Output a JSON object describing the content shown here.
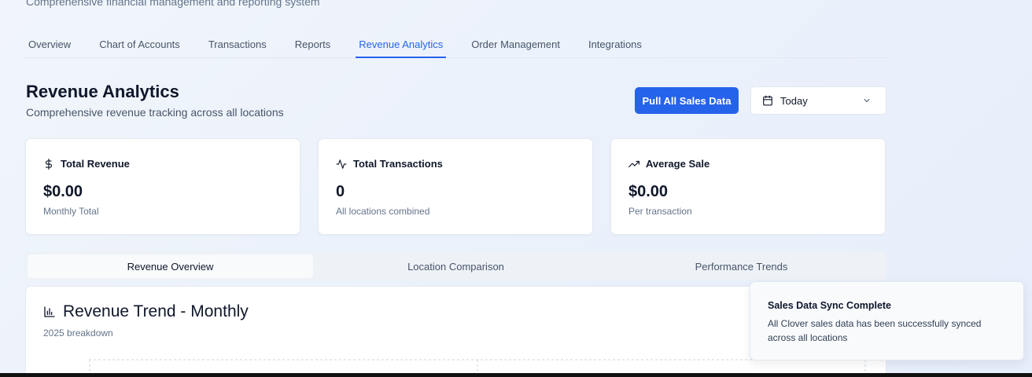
{
  "header": {
    "subtitle": "Comprehensive financial management and reporting system"
  },
  "nav": {
    "tabs": [
      {
        "label": "Overview"
      },
      {
        "label": "Chart of Accounts"
      },
      {
        "label": "Transactions"
      },
      {
        "label": "Reports"
      },
      {
        "label": "Revenue Analytics",
        "active": true
      },
      {
        "label": "Order Management"
      },
      {
        "label": "Integrations"
      }
    ]
  },
  "page": {
    "title": "Revenue Analytics",
    "description": "Comprehensive revenue tracking across all locations",
    "pull_button": "Pull All Sales Data",
    "date_range": {
      "selected": "Today"
    }
  },
  "stats": [
    {
      "icon": "dollar-icon",
      "label": "Total Revenue",
      "value": "$0.00",
      "sub": "Monthly Total"
    },
    {
      "icon": "activity-icon",
      "label": "Total Transactions",
      "value": "0",
      "sub": "All locations combined"
    },
    {
      "icon": "trending-up-icon",
      "label": "Average Sale",
      "value": "$0.00",
      "sub": "Per transaction"
    }
  ],
  "subtabs": [
    {
      "label": "Revenue Overview",
      "active": true
    },
    {
      "label": "Location Comparison"
    },
    {
      "label": "Performance Trends"
    }
  ],
  "chart": {
    "title": "Revenue Trend - Monthly",
    "description": "2025 breakdown"
  },
  "toast": {
    "title": "Sales Data Sync Complete",
    "body": "All Clover sales data has been successfully synced across all locations"
  },
  "colors": {
    "accent": "#2563eb",
    "text": "#0f172a",
    "muted": "#64748b"
  }
}
